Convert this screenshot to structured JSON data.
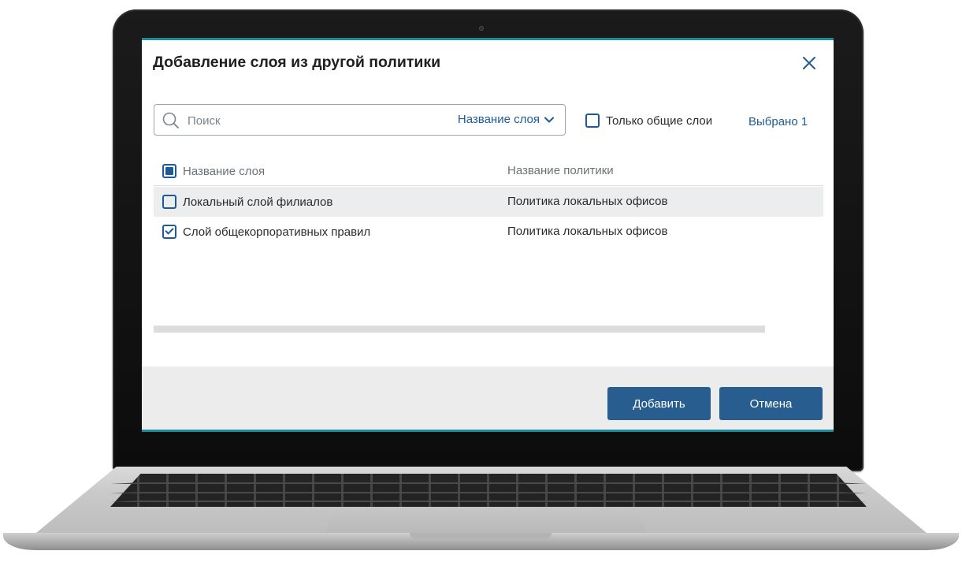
{
  "dialog": {
    "title": "Добавление слоя из другой политики",
    "search": {
      "placeholder": "Поиск",
      "scope_label": "Название слоя"
    },
    "only_common_layers_label": "Только общие слои",
    "only_common_layers_checked": false,
    "selected_label": "Выбрано 1",
    "table": {
      "columns": [
        "Название слоя",
        "Название политики"
      ],
      "header_checkbox_state": "partial",
      "rows": [
        {
          "name": "Локальный слой филиалов",
          "policy": "Политика локальных офисов",
          "checked": false,
          "highlighted": true
        },
        {
          "name": "Слой общекорпоративных правил",
          "policy": "Политика локальных офисов",
          "checked": true,
          "highlighted": false
        }
      ]
    },
    "buttons": {
      "add": "Добавить",
      "cancel": "Отмена"
    }
  },
  "colors": {
    "accent": "#1e5a96",
    "primary_button": "#285d8f",
    "frame_stripe": "#1f8a9b",
    "footer_bg": "#ececec",
    "row_highlight": "#ebedee"
  },
  "icons": {
    "search": "search-icon",
    "close": "close-icon",
    "dropdown": "chevron-down-icon"
  }
}
